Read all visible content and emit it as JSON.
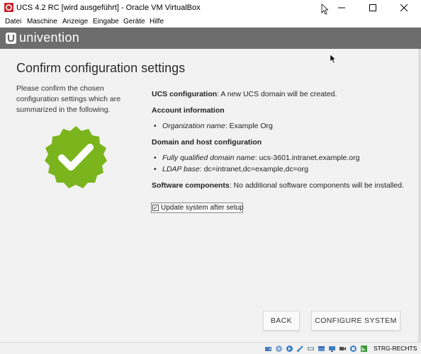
{
  "window": {
    "title": "UCS 4.2 RC [wird ausgeführt] - Oracle VM VirtualBox",
    "minimize_icon": "minimize-icon",
    "maximize_icon": "maximize-icon",
    "close_icon": "close-icon"
  },
  "menu": [
    "Datei",
    "Maschine",
    "Anzeige",
    "Eingabe",
    "Geräte",
    "Hilfe"
  ],
  "brand": {
    "name": "univention",
    "color": "#6d6d6d"
  },
  "page": {
    "title": "Confirm configuration settings",
    "intro": "Please confirm the chosen configuration settings which are summarized in the following.",
    "badge_color": "#7ab51d"
  },
  "summary": {
    "ucs_label": "UCS configuration",
    "ucs_value": ": A new UCS domain will be created.",
    "account_heading": "Account information",
    "org_label": "Organization name",
    "org_value": ": Example Org",
    "domain_heading": "Domain and host configuration",
    "fqdn_label": "Fully qualified domain name",
    "fqdn_value": ": ucs-3601.intranet.example.org",
    "ldap_label": "LDAP base",
    "ldap_value": ": dc=intranet,dc=example,dc=org",
    "software_label": "Software components",
    "software_value": ": No additional software components will be installed."
  },
  "update_checkbox": {
    "label": "Update system after setup",
    "checked": true,
    "mark": "✓"
  },
  "buttons": {
    "back": "BACK",
    "configure": "CONFIGURE SYSTEM"
  },
  "statusbar": {
    "host_key": "STRG-RECHTS"
  }
}
